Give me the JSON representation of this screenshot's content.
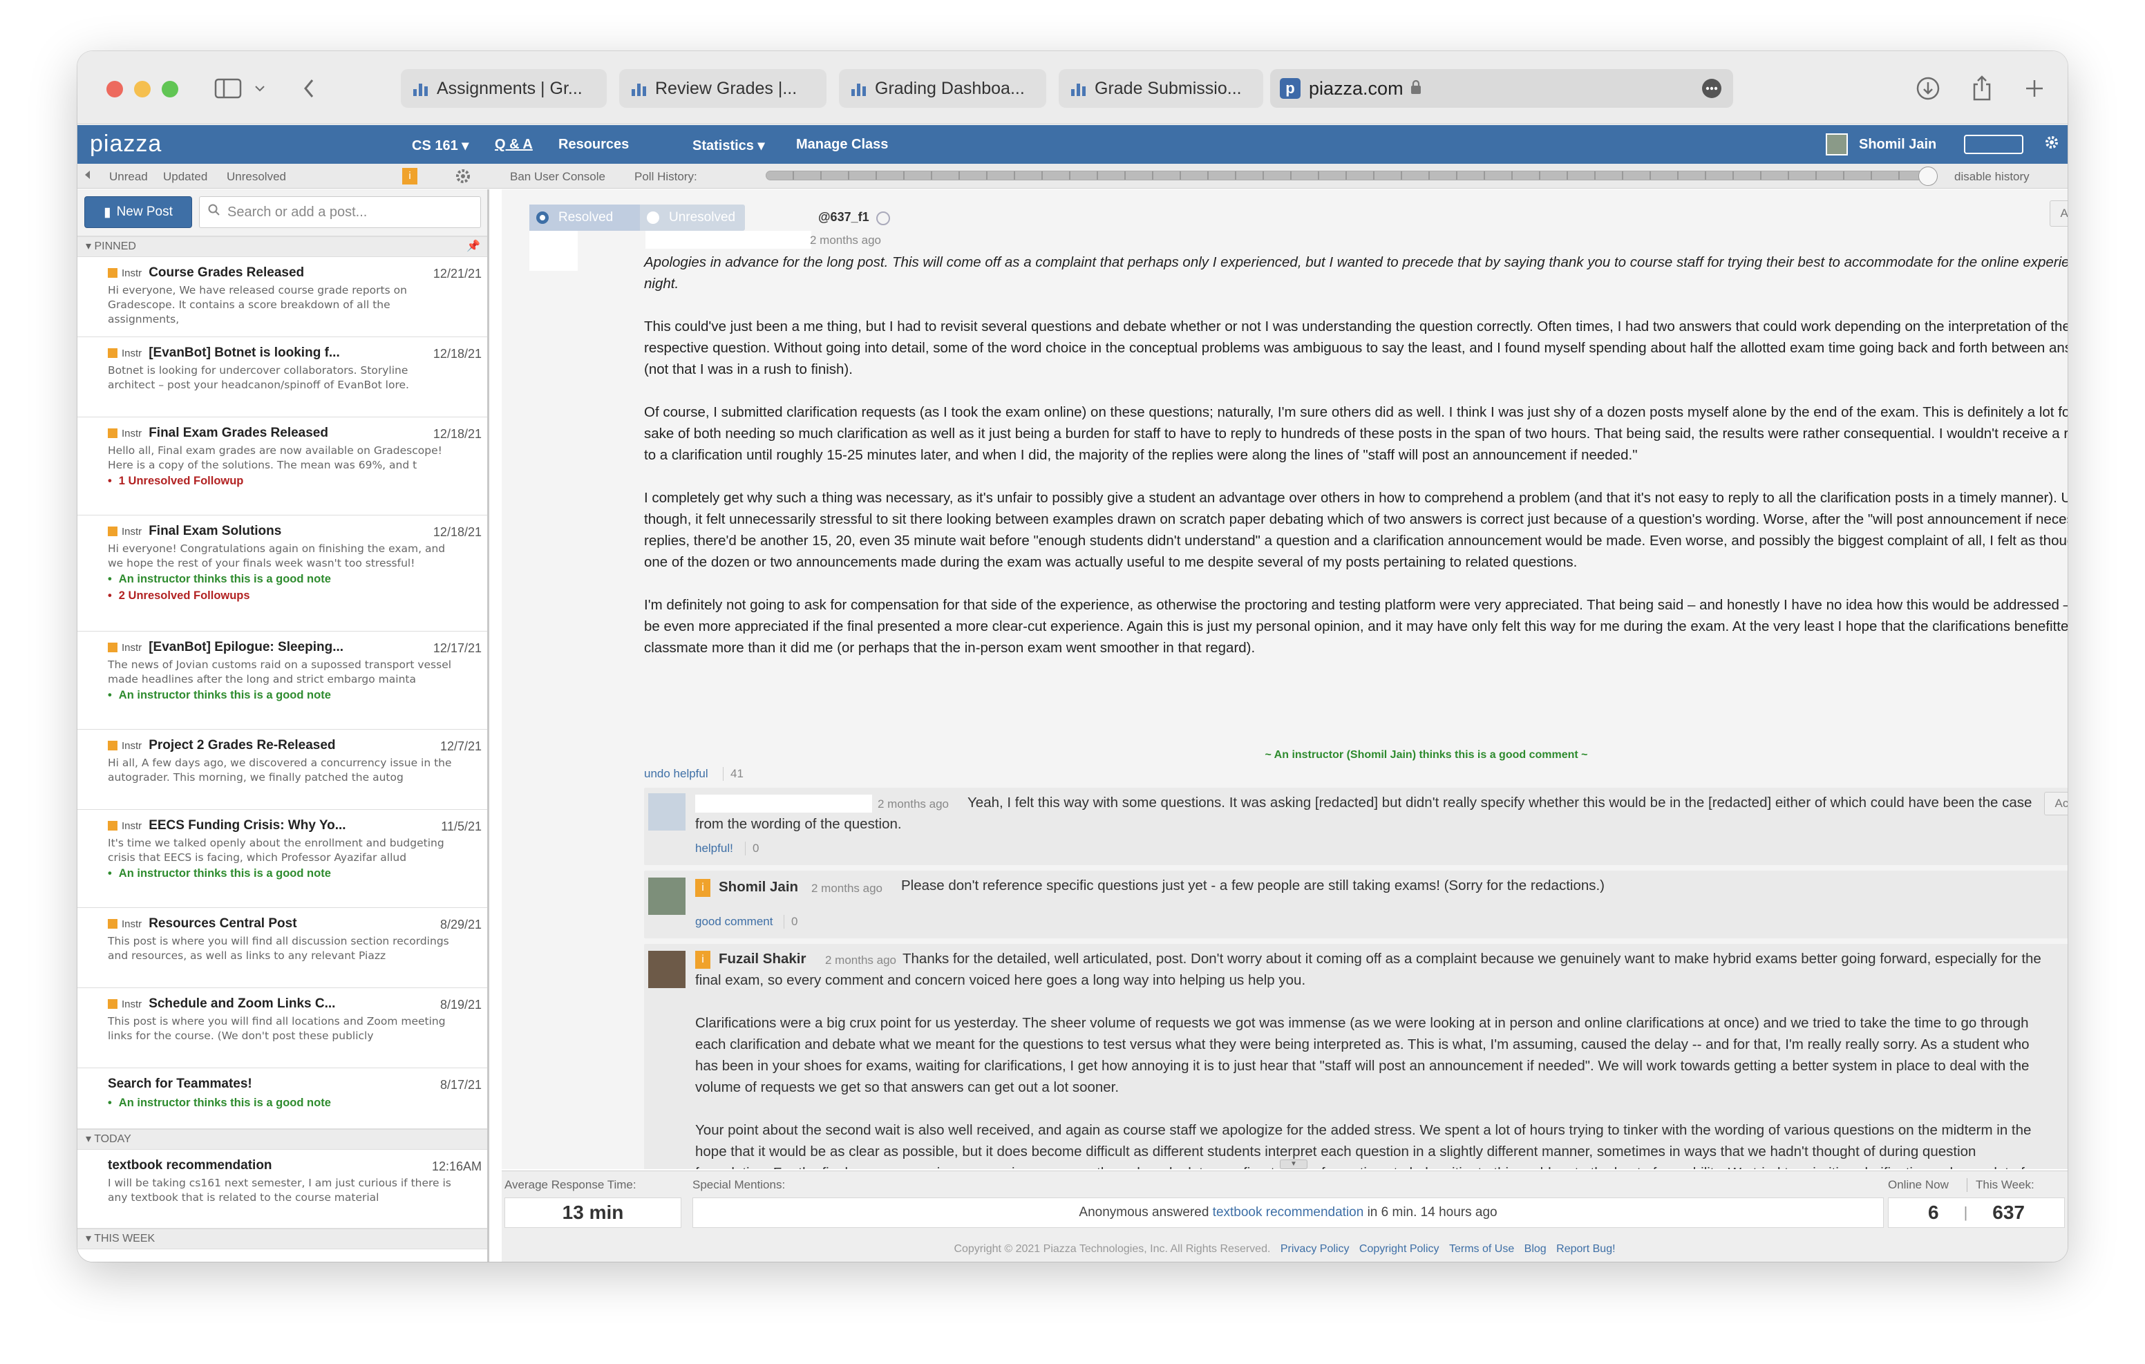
{
  "browser": {
    "tabs": [
      "Assignments | Gr...",
      "Review Grades |...",
      "Grading Dashboa...",
      "Grade Submissio..."
    ],
    "url": "piazza.com"
  },
  "nav": {
    "logo": "piazza",
    "course": "CS 161 ▾",
    "qa": "Q & A",
    "resources": "Resources",
    "statistics": "Statistics ▾",
    "manage": "Manage Class",
    "user": "Shomil Jain"
  },
  "subbar": {
    "unread": "Unread",
    "updated": "Updated",
    "unresolved": "Unresolved",
    "ban": "Ban User Console",
    "poll": "Poll History:",
    "disable": "disable history"
  },
  "sidebar": {
    "new_post": "New Post",
    "search_placeholder": "Search or add a post...",
    "pinned": "PINNED",
    "today": "TODAY",
    "this_week": "THIS WEEK",
    "instr": "Instr",
    "posts": [
      {
        "title": "Course Grades Released",
        "date": "12/21/21",
        "snippet": "Hi everyone, We have released course grade reports on Gradescope. It contains a score breakdown of all the assignments,",
        "tags": []
      },
      {
        "title": "[EvanBot] Botnet is looking f...",
        "date": "12/18/21",
        "snippet": "Botnet is looking for undercover collaborators. Storyline architect – post your headcanon/spinoff of EvanBot lore.",
        "tags": []
      },
      {
        "title": "Final Exam Grades Released",
        "date": "12/18/21",
        "snippet": "Hello all, Final exam grades are now available on Gradescope! Here is a copy of the solutions. The mean was 69%, and t",
        "tags": [
          {
            "text": "1 Unresolved Followup",
            "kind": "r"
          }
        ]
      },
      {
        "title": "Final Exam Solutions",
        "date": "12/18/21",
        "snippet": "Hi everyone! Congratulations again on finishing the exam, and we hope the rest of your finals week wasn't too stressful!",
        "tags": [
          {
            "text": "An instructor thinks this is a good note",
            "kind": "g"
          },
          {
            "text": "2 Unresolved Followups",
            "kind": "r"
          }
        ]
      },
      {
        "title": "[EvanBot] Epilogue: Sleeping...",
        "date": "12/17/21",
        "snippet": "The news of Jovian customs raid on a supossed transport vessel made headlines after the long and strict embargo mainta",
        "tags": [
          {
            "text": "An instructor thinks this is a good note",
            "kind": "g"
          }
        ]
      },
      {
        "title": "Project 2 Grades Re-Released",
        "date": "12/7/21",
        "snippet": "Hi all, A few days ago, we discovered a concurrency issue in the autograder. This morning, we finally patched the autog",
        "tags": []
      },
      {
        "title": "EECS Funding Crisis: Why Yo...",
        "date": "11/5/21",
        "snippet": "It's time we talked openly about the enrollment and budgeting crisis that EECS is facing, which Professor Ayazifar allud",
        "tags": [
          {
            "text": "An instructor thinks this is a good note",
            "kind": "g"
          }
        ]
      },
      {
        "title": "Resources Central Post",
        "date": "8/29/21",
        "snippet": "This post is where you will find all discussion section recordings and resources, as well as links to any relevant Piazz",
        "tags": []
      },
      {
        "title": "Schedule and Zoom Links C...",
        "date": "8/19/21",
        "snippet": "This post is where you will find all locations and Zoom meeting links for the course. (We don't post these publicly",
        "tags": []
      }
    ],
    "teammates": {
      "title": "Search for Teammates!",
      "date": "8/17/21",
      "tag": "An instructor thinks this is a good note"
    },
    "today_post": {
      "title": "textbook recommendation",
      "date": "12:16AM",
      "snippet": "I will be taking cs161 next semester, I am just curious if there is any textbook that is related to the course material"
    }
  },
  "main": {
    "resolved": "Resolved",
    "unresolved": "Unresolved",
    "post_id": "@637_f1",
    "actions": "Actions ▾",
    "time": "2 months ago",
    "p1": "Apologies in advance for the long post. This will come off as a complaint that perhaps only I experienced, but I wanted to precede that by saying thank you to course staff for trying their best to accommodate for the online experience last night.",
    "p2": "This could've just been a me thing, but I had to revisit several questions and debate whether or not I was understanding the question correctly. Often times, I had two answers that could work depending on the interpretation of the respective question. Without going into detail, some of the word choice in the conceptual problems was ambiguous to say the least, and I found myself spending about half the allotted exam time going back and forth between answers (not that I was in a rush to finish).",
    "p3": "Of course, I submitted clarification requests (as I took the exam online) on these questions; naturally, I'm sure others did as well. I think I was just shy of a dozen posts myself alone by the end of the exam. This is definitely a lot for the sake of both needing so much clarification as well as it just being a burden for staff to have to reply to hundreds of these posts in the span of two hours. That being said, the results were rather consequential. I wouldn't receive a response to a clarification until roughly 15-25 minutes later, and when I did, the majority of the replies were along the lines of \"staff will post an announcement if needed.\"",
    "p4": "I completely get why such a thing was necessary, as it's unfair to possibly give a student an advantage over others in how to comprehend a problem (and that it's not easy to reply to all the clarification posts in a timely manner). Ultimately though, it felt unnecessarily stressful to sit there looking between examples drawn on scratch paper debating which of two answers is correct just because of a question's wording. Worse, after the \"will post announcement if necessary\" replies, there'd be another 15, 20, even 35 minute wait before \"enough students didn't understand\" a question and a clarification announcement would be made. Even worse, and possibly the biggest complaint of all, I felt as though only one of the dozen or two announcements made during the exam was actually useful to me despite several of my posts pertaining to related questions.",
    "p5": "I'm definitely not going to ask for compensation for that side of the experience, as otherwise the proctoring and testing platform were very appreciated. That being said – and honestly I have no idea how this would be addressed – it was be even more appreciated if the final presented a more clear-cut experience. Again this is just my personal opinion, and it may have only felt this way for me during the exam. At the very least I hope that the clarifications benefitted a classmate more than it did me (or perhaps that the in-person exam went smoother in that regard).",
    "good_comment_note": "~ An instructor (Shomil Jain) thinks this is a good comment ~",
    "undo_helpful": "undo helpful",
    "helpful_count": "41",
    "f1": {
      "time": "2 months ago",
      "text": "Yeah, I felt this way with some questions. It was asking [redacted] but didn't really specify whether this would be in the [redacted] either of which could have been the case from the wording of the question.",
      "action": "helpful!",
      "count": "0"
    },
    "f2": {
      "name": "Shomil Jain",
      "time": "2 months ago",
      "text": "Please don't reference specific questions just yet - a few people are still taking exams! (Sorry for the redactions.)",
      "action": "good comment",
      "count": "0"
    },
    "f3": {
      "name": "Fuzail Shakir",
      "time": "2 months ago",
      "p1": "Thanks for the detailed, well articulated, post. Don't worry about it coming off as a complaint because we genuinely want to make hybrid exams better going forward, especially for the final exam, so every comment and concern voiced here goes a long way into helping us help you.",
      "p2": "Clarifications were a big crux point for us yesterday. The sheer volume of requests we got was immense (as we were looking at in person and online clarifications at once) and we tried to take the time to go through each clarification and debate what we meant for the questions to test versus what they were being interpreted as. This is what, I'm assuming, caused the delay -- and for that, I'm really really sorry. As a student who has been in your shoes for exams, waiting for clarifications, I get how annoying it is to just hear that \"staff will post an announcement if needed\". We will work towards getting a better system in place to deal with the volume of requests we get so that answers can get out a lot sooner.",
      "p3": "Your point about the second wait is also well received, and again as course staff we apologize for the added stress. We spent a lot of hours trying to tinker with the wording of various questions on the midterm in the hope that it would be as clear as possible, but it does become difficult as different students interpret each question in a slightly different manner, sometimes in ways that we hadn't thought of during question formulation. For the final, we can promise a more rigorous pass-through and a lot more fine-tuning of questions to help mitigate this problem to the best of our ability. We tried to prioritize clarifications where a lot of students had questions about a portion of a question, which would result in us issuing a clarification -- obviously, this led to huge wait times between question asking and clarifications being issued and this also meant that some clarifications simply could not be answered in time. And I can promise you we will get a better system in place for the final exam so that clarifications"
    }
  },
  "bottom": {
    "avg_label": "Average Response Time:",
    "avg_value": "13 min",
    "mentions_label": "Special Mentions:",
    "mention_pre": "Anonymous answered ",
    "mention_link": "textbook recommendation",
    "mention_post": " in 6 min. 14 hours ago",
    "online_label": "Online Now",
    "week_label": "This Week:",
    "online_value": "6",
    "week_value": "637",
    "copyright": "Copyright © 2021 Piazza Technologies, Inc. All Rights Reserved.",
    "links": [
      "Privacy Policy",
      "Copyright Policy",
      "Terms of Use",
      "Blog",
      "Report Bug!"
    ]
  }
}
